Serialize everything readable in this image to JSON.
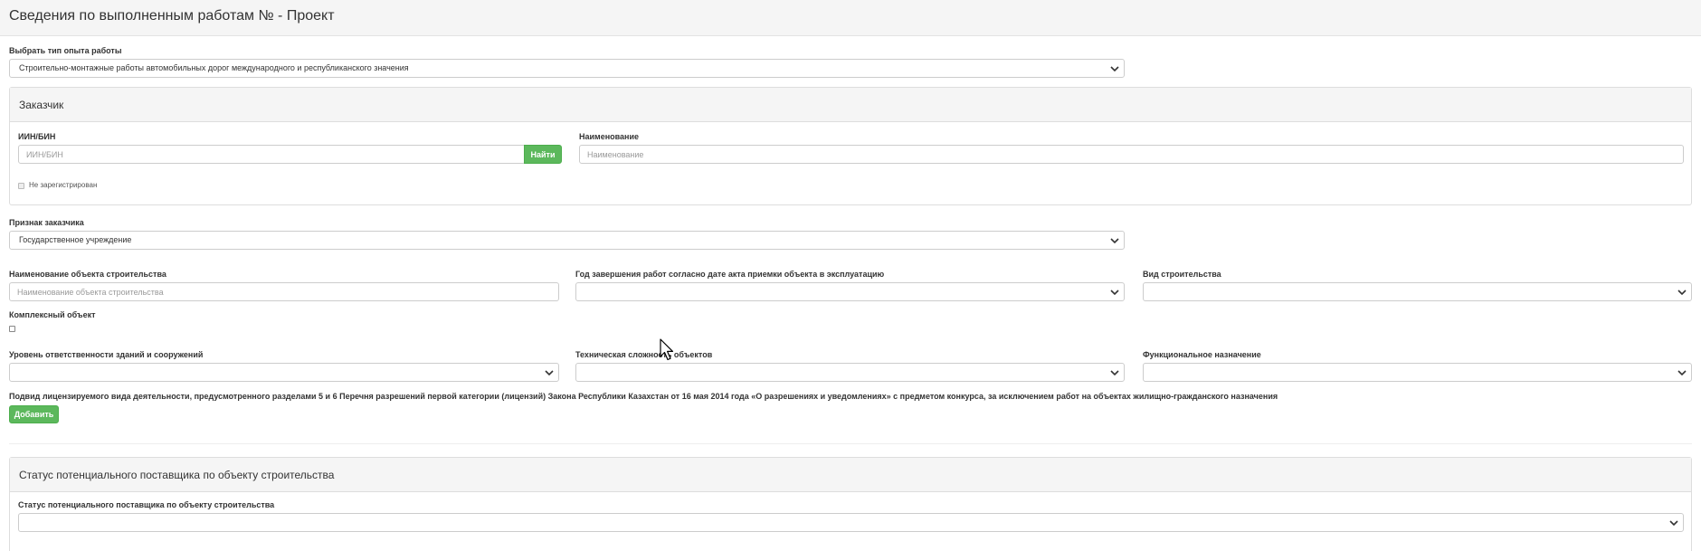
{
  "header": {
    "title": "Сведения по выполненным работам № - Проект"
  },
  "experience_type": {
    "label": "Выбрать тип опыта работы",
    "value": "Строительно-монтажные работы автомобильных дорог международного и республиканского значения"
  },
  "customer": {
    "panel_title": "Заказчик",
    "iin_label": "ИИН/БИН",
    "iin_placeholder": "ИИН/БИН",
    "find_button": "Найти",
    "name_label": "Наименование",
    "name_placeholder": "Наименование",
    "not_registered_label": "Не зарегистрирован"
  },
  "customer_sign": {
    "label": "Признак заказчика",
    "value": "Государственное учреждение"
  },
  "object": {
    "name_label": "Наименование объекта строительства",
    "name_placeholder": "Наименование объекта строительства",
    "year_label": "Год завершения работ согласно дате акта приемки объекта в эксплуатацию",
    "year_value": "",
    "construction_type_label": "Вид строительства",
    "construction_type_value": "",
    "complex_label": "Комплексный объект",
    "responsibility_label": "Уровень ответственности зданий и сооружений",
    "responsibility_value": "",
    "complexity_label": "Техническая сложность объектов",
    "complexity_value": "",
    "purpose_label": "Функциональное назначение",
    "purpose_value": ""
  },
  "subtype": {
    "label": "Подвид лицензируемого вида деятельности, предусмотренного разделами 5 и 6 Перечня разрешений первой категории (лицензий) Закона Республики Казахстан от 16 мая 2014 года «О разрешениях и уведомлениях» с предметом конкурса, за исключением работ на объектах жилищно-гражданского назначения",
    "add_button": "Добавить"
  },
  "supplier_status": {
    "panel_title": "Статус потенциального поставщика по объекту строительства",
    "label": "Статус потенциального поставщика по объекту строительства",
    "value": ""
  },
  "icons": {
    "dropdown": "chevron-down-icon",
    "pointer": "mouse-cursor-icon"
  },
  "colors": {
    "accent_green": "#5cb85c",
    "panel_heading": "#f5f5f5",
    "border": "#cccccc"
  }
}
